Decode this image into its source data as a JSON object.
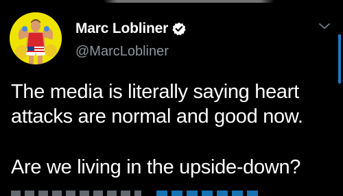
{
  "tweet": {
    "author": {
      "display_name": "Marc Lobliner",
      "handle": "@MarcLobliner",
      "verified": true,
      "avatar_icon": "profile-photo-avatar"
    },
    "text_lines": [
      "The media is literally saying heart",
      "attacks are normal and good now.",
      "",
      "Are we living in the upside-down?"
    ],
    "menu_icon": "chevron-down-icon"
  },
  "colors": {
    "background": "#000000",
    "text": "#ffffff",
    "handle": "#8e959d",
    "accent": "#1d9bf0",
    "avatar_bg": "#efe300"
  }
}
